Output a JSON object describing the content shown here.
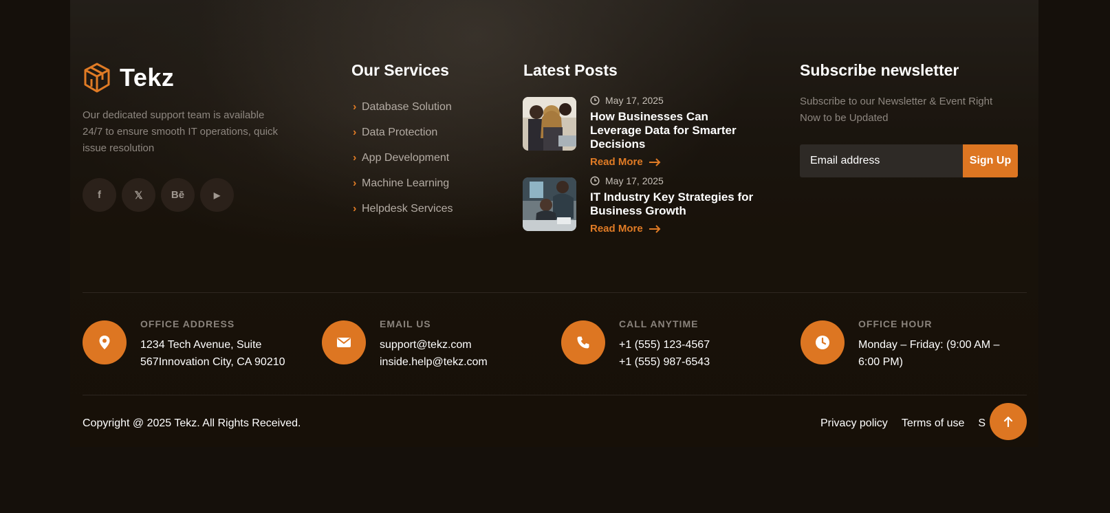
{
  "brand": {
    "name": "Tekz",
    "about": "Our dedicated support team is available 24/7 to ensure smooth IT operations, quick issue resolution",
    "logo_icon": "cube-network-logo-icon"
  },
  "socials": [
    {
      "name": "facebook",
      "glyph": "f"
    },
    {
      "name": "x-twitter",
      "glyph": "𝕏"
    },
    {
      "name": "behance",
      "glyph": "Bē"
    },
    {
      "name": "youtube",
      "glyph": "▶"
    }
  ],
  "services": {
    "title": "Our Services",
    "items": [
      "Database Solution",
      "Data Protection",
      "App Development",
      "Machine Learning",
      "Helpdesk Services"
    ]
  },
  "posts": {
    "title": "Latest Posts",
    "items": [
      {
        "date": "May 17, 2025",
        "title": "How Businesses Can Leverage Data for Smarter Decisions",
        "read_more": "Read More"
      },
      {
        "date": "May 17, 2025",
        "title": "IT Industry Key Strategies for Business Growth",
        "read_more": "Read More"
      }
    ]
  },
  "newsletter": {
    "title": "Subscribe newsletter",
    "text": "Subscribe to our Newsletter & Event Right Now to be Updated",
    "placeholder": "Email address",
    "button": "Sign Up"
  },
  "contact": [
    {
      "label": "OFFICE ADDRESS",
      "lines": [
        "1234 Tech Avenue, Suite",
        "567Innovation City, CA 90210"
      ],
      "icon": "map-pin-icon"
    },
    {
      "label": "EMAIL US",
      "lines": [
        "support@tekz.com",
        "inside.help@tekz.com"
      ],
      "icon": "envelope-icon"
    },
    {
      "label": "CALL ANYTIME",
      "lines": [
        "+1 (555) 123-4567",
        "+1 (555) 987-6543"
      ],
      "icon": "phone-icon"
    },
    {
      "label": "OFFICE HOUR",
      "lines": [
        "Monday – Friday: (9:00 AM –",
        "6:00 PM)"
      ],
      "icon": "clock-icon"
    }
  ],
  "bottom": {
    "copyright": "Copyright @ 2025 Tekz. All Rights Received.",
    "links": [
      "Privacy policy",
      "Terms of use",
      "S"
    ]
  },
  "colors": {
    "accent": "#dd7622",
    "background": "#15100b"
  }
}
